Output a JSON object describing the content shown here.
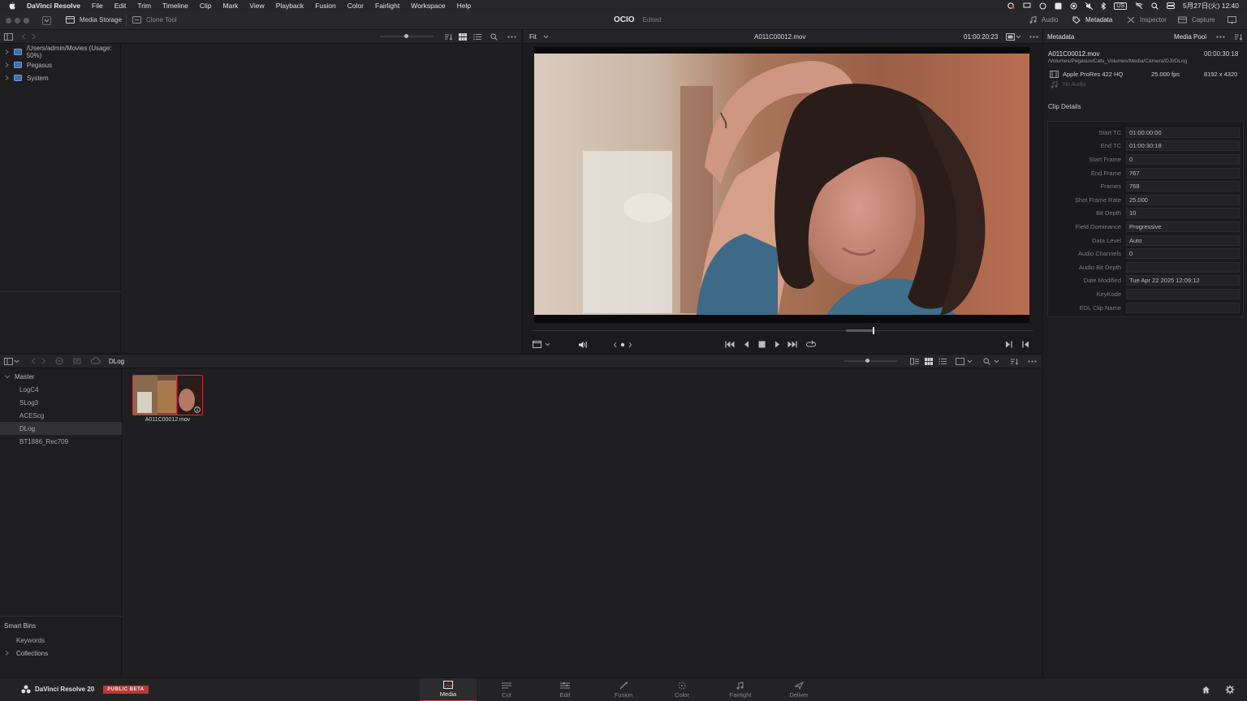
{
  "menubar": {
    "app_name": "DaVinci Resolve",
    "items": [
      "File",
      "Edit",
      "Trim",
      "Timeline",
      "Clip",
      "Mark",
      "View",
      "Playback",
      "Fusion",
      "Color",
      "Fairlight",
      "Workspace",
      "Help"
    ],
    "keyboard": "US",
    "clock": "5月27日(火) 12:40"
  },
  "toolbar": {
    "media_storage": "Media Storage",
    "clone_tool": "Clone Tool",
    "project_title": "OCIO",
    "project_status": "Edited",
    "audio": "Audio",
    "metadata": "Metadata",
    "inspector": "Inspector",
    "capture": "Capture"
  },
  "storage": {
    "locations": [
      {
        "label": "/Users/admin/Movies (Usage: 50%)"
      },
      {
        "label": "Pegasus"
      },
      {
        "label": "System"
      }
    ]
  },
  "viewer": {
    "zoom": "Fit",
    "clip_name": "A011C00012.mov",
    "timecode": "01:00:20:23",
    "playhead_fraction": 0.68
  },
  "media_pool": {
    "current_bin": "DLog",
    "bins": [
      "Master",
      "LogC4",
      "SLog3",
      "ACEScg",
      "DLog",
      "BT1886_Rec709"
    ],
    "selected_bin": "DLog",
    "smart_bins_title": "Smart Bins",
    "smart_bins": [
      "Keywords",
      "Collections"
    ],
    "clips": [
      {
        "name": "A011C00012.mov"
      }
    ]
  },
  "metadata_panel": {
    "title": "Metadata",
    "pool_label": "Media Pool",
    "clip_name": "A011C00012.mov",
    "duration": "00:00:30:18",
    "path": "/Volumes/Pegasus/Cafu_Volumes/Media/Camera/DJI/DLog",
    "codec": "Apple ProRes 422 HQ",
    "fps": "25.000 fps",
    "resolution": "8192 x 4320",
    "audio": "No Audio",
    "section_title": "Clip Details",
    "fields": [
      {
        "label": "Start TC",
        "value": "01:00:00:00"
      },
      {
        "label": "End TC",
        "value": "01:00:30:18"
      },
      {
        "label": "Start Frame",
        "value": "0"
      },
      {
        "label": "End Frame",
        "value": "767"
      },
      {
        "label": "Frames",
        "value": "768"
      },
      {
        "label": "Shot Frame Rate",
        "value": "25.000"
      },
      {
        "label": "Bit Depth",
        "value": "10"
      },
      {
        "label": "Field Dominance",
        "value": "Progressive"
      },
      {
        "label": "Data Level",
        "value": "Auto"
      },
      {
        "label": "Audio Channels",
        "value": "0"
      },
      {
        "label": "Audio Bit Depth",
        "value": ""
      },
      {
        "label": "Date Modified",
        "value": "Tue Apr 22 2025 12:09:12"
      },
      {
        "label": "KeyKode",
        "value": ""
      },
      {
        "label": "EDL Clip Name",
        "value": ""
      }
    ]
  },
  "bottom": {
    "product": "DaVinci Resolve 20",
    "badge": "PUBLIC BETA",
    "pages": [
      {
        "label": "Media",
        "icon": "media-page-icon"
      },
      {
        "label": "Cut",
        "icon": "cut-page-icon"
      },
      {
        "label": "Edit",
        "icon": "edit-page-icon"
      },
      {
        "label": "Fusion",
        "icon": "fusion-page-icon"
      },
      {
        "label": "Color",
        "icon": "color-page-icon"
      },
      {
        "label": "Fairlight",
        "icon": "fairlight-page-icon"
      },
      {
        "label": "Deliver",
        "icon": "deliver-page-icon"
      }
    ],
    "active_page": "Media"
  },
  "colors": {
    "accent_red": "#c4333a",
    "panel_bg": "#1e1e20"
  }
}
